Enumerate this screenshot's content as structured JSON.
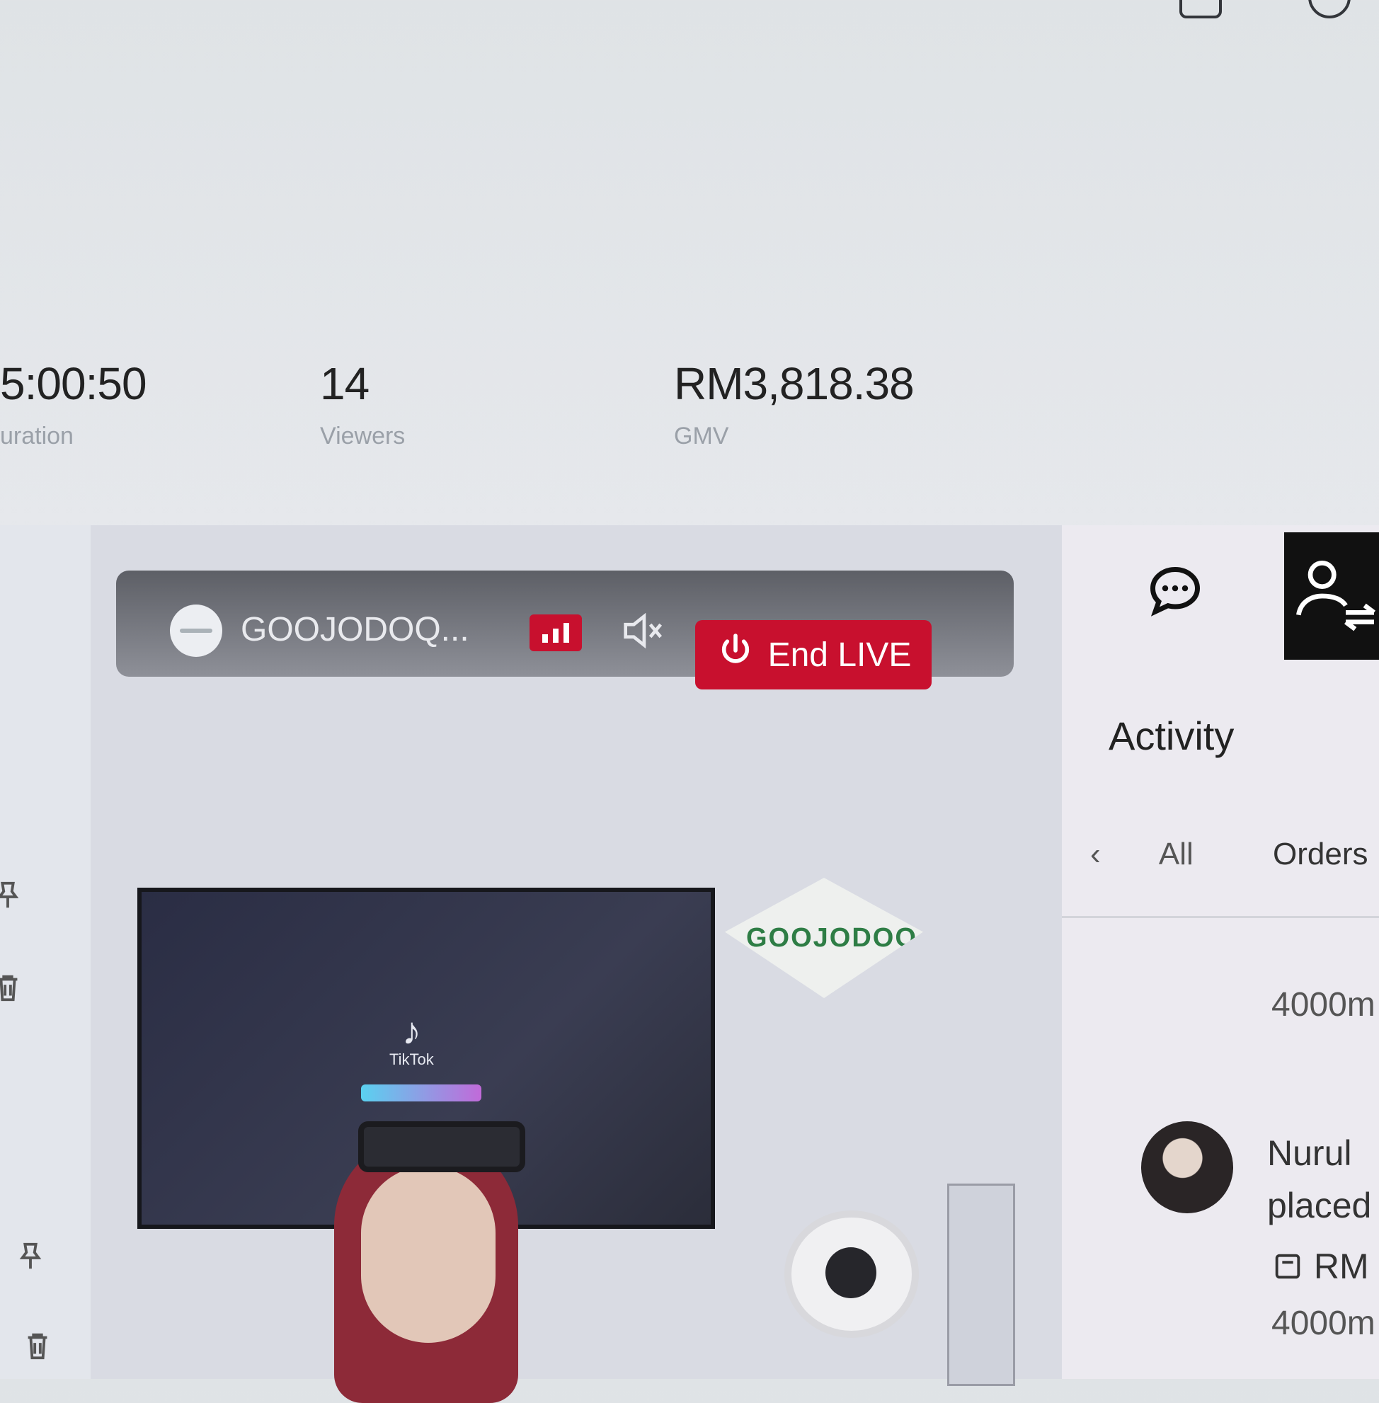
{
  "stats": [
    {
      "value": "5:00:50",
      "label": "uration"
    },
    {
      "value": "14",
      "label": "Viewers"
    },
    {
      "value": "RM3,818.38",
      "label": "GMV"
    }
  ],
  "live": {
    "handle": "GOOJODOQ...",
    "end_button": "End LIVE",
    "tv_app_label": "TikTok",
    "logo_text": "GOOJODOQ"
  },
  "panel": {
    "title": "Activity",
    "tabs": {
      "back": "‹",
      "all": "All",
      "orders": "Orders"
    },
    "feed": [
      {
        "amount_top": "4000m"
      },
      {
        "buyer": "Nurul",
        "action": "placed",
        "price": "RM",
        "amount": "4000m"
      }
    ]
  },
  "colors": {
    "accent_red": "#c8102e",
    "selected_tab_bg": "#111111"
  },
  "icons": [
    "bell-icon",
    "settings-icon",
    "stats-icon",
    "mute-icon",
    "power-icon",
    "chat-icon",
    "user-switch-icon",
    "pin-icon",
    "delete-icon",
    "order-icon"
  ]
}
